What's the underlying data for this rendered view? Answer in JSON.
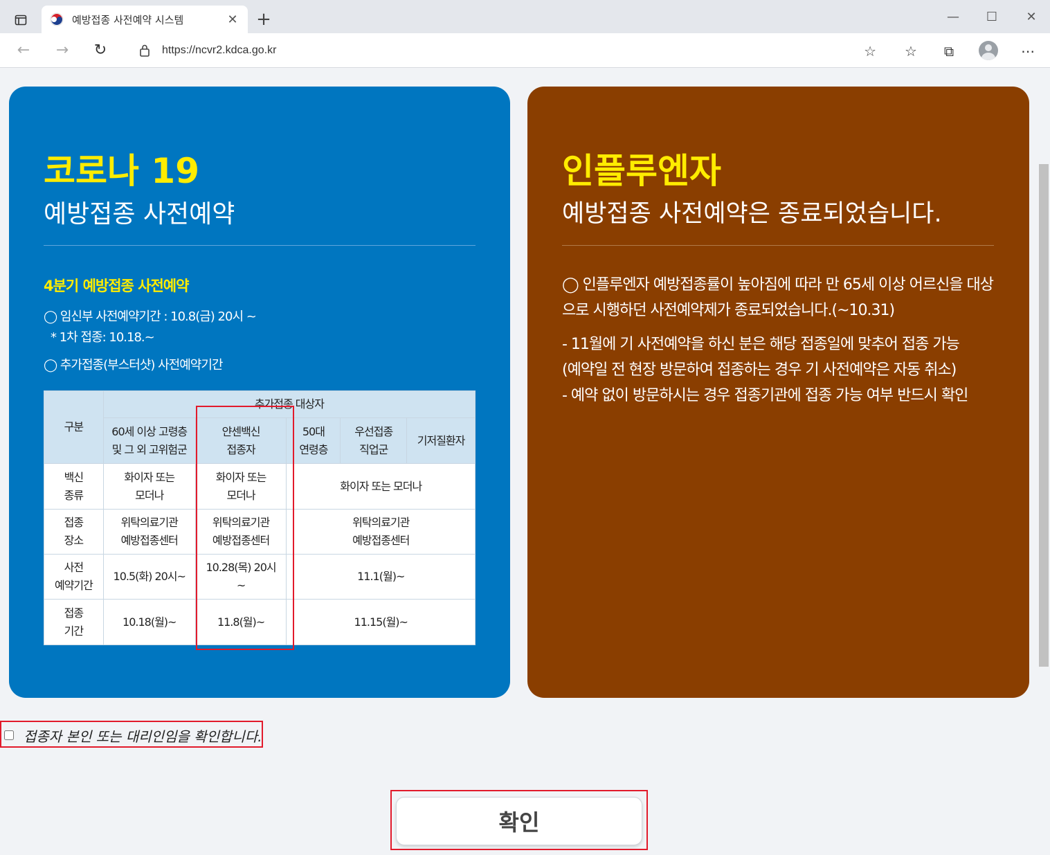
{
  "browser": {
    "tab_title": "예방접종 사전예약 시스템",
    "url": "https://ncvr2.kdca.go.kr",
    "new_tab_label": "+",
    "close_tab_label": "✕"
  },
  "covid": {
    "title": "코로나 19",
    "subtitle": "예방접종 사전예약",
    "section_title": "4분기 예방접종 사전예약",
    "lines": [
      "◯ 임신부 사전예약기간 : 10.8(금) 20시 ~",
      "* 1차 접종: 10.18.~",
      "◯ 추가접종(부스터샷) 사전예약기간"
    ],
    "table": {
      "header_category": "구분",
      "header_group": "추가접종 대상자",
      "columns": [
        "60세 이상 고령층\n및 그 외 고위험군",
        "얀센백신\n접종자",
        "50대\n연령층",
        "우선접종\n직업군",
        "기저질환자"
      ],
      "rows": [
        {
          "label": "백신\n종류",
          "c1": "화이자 또는\n모더나",
          "c2": "화이자 또는\n모더나",
          "rest": "화이자 또는 모더나"
        },
        {
          "label": "접종\n장소",
          "c1": "위탁의료기관\n예방접종센터",
          "c2": "위탁의료기관\n예방접종센터",
          "rest": "위탁의료기관\n예방접종센터"
        },
        {
          "label": "사전\n예약기간",
          "c1": "10.5(화) 20시~",
          "c2": "10.28(목) 20시\n~",
          "rest": "11.1(월)~"
        },
        {
          "label": "접종\n기간",
          "c1": "10.18(월)~",
          "c2": "11.8(월)~",
          "rest": "11.15(월)~"
        }
      ]
    }
  },
  "flu": {
    "title": "인플루엔자",
    "subtitle": "예방접종 사전예약은 종료되었습니다.",
    "paragraph1": "◯ 인플루엔자 예방접종률이 높아짐에 따라 만 65세 이상 어르신을 대상으로 시행하던 사전예약제가 종료되었습니다.(~10.31)",
    "paragraph2": "- 11월에 기 사전예약을 하신 분은 해당 접종일에 맞추어 접종 가능\n (예약일 전 현장 방문하여 접종하는 경우 기 사전예약은 자동 취소)\n- 예약 없이 방문하시는 경우 접종기관에 접종 가능 여부 반드시 확인"
  },
  "consent": {
    "label": "접종자 본인 또는 대리인임을 확인합니다.",
    "checked": false
  },
  "confirm_button": "확인",
  "colors": {
    "covid_card": "#0076c0",
    "flu_card": "#8a3e00",
    "title_yellow": "#ffec00",
    "highlight_red": "#e21a2b"
  }
}
